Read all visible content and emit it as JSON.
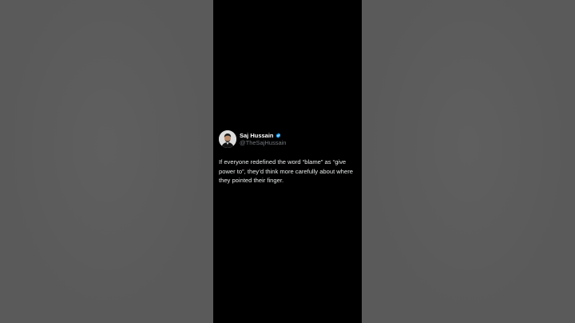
{
  "tweet": {
    "author": {
      "display_name": "Saj Hussain",
      "handle": "@TheSajHussain",
      "verified_icon": "verified-badge-icon",
      "avatar_icon": "profile-photo"
    },
    "text": "If everyone redefined the word “blame” as “give power to”, they’d think more carefully about where they pointed their finger."
  },
  "colors": {
    "background_side": "#5a5a5a",
    "frame": "#000000",
    "text": "#e7e9ea",
    "handle": "#71767b",
    "verified": "#1d9bf0"
  }
}
